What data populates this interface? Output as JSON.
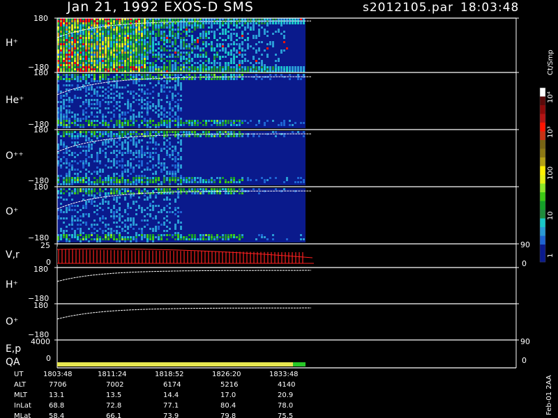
{
  "header": {
    "title": "Jan 21, 1992   EXOS-D SMS",
    "file": "s2012105.par",
    "time": "18:03:48"
  },
  "colorbar": {
    "unit": "Ct/Smp",
    "tick_labels": [
      "1",
      "10",
      "100",
      "10³",
      "10⁴"
    ],
    "colors": [
      "#0a1a8c",
      "#0a1a8c",
      "#1e64d2",
      "#2a9bd6",
      "#19c8c8",
      "#1f8c3c",
      "#14a028",
      "#3cc814",
      "#8ce628",
      "#e6f014",
      "#fff000",
      "#b4a014",
      "#8c7814",
      "#786414",
      "#c83214",
      "#ff1400",
      "#b41414",
      "#8c0a0a",
      "#5a0a0a",
      "#ffffff"
    ]
  },
  "panels": {
    "hplus_label": "H⁺",
    "heplus_label": "He⁺",
    "opp_label": "O⁺⁺",
    "oplus_label": "O⁺",
    "vr_label": "V,r",
    "hplus2_label": "H⁺",
    "oplus2_label": "O⁺",
    "ep_label": "E,p",
    "qa_label": "QA",
    "tick_pos": "180",
    "tick_neg": "−180",
    "vr_top": "25",
    "vr_zero": "0",
    "right_90": "90",
    "right_0": "0",
    "ep_top": "4000",
    "ep_zero": "0",
    "ep_90": "90",
    "ep_0": "0"
  },
  "footer": {
    "rows": [
      {
        "label": "UT",
        "values": [
          "1803:48",
          "1811:24",
          "1818:52",
          "1826:20",
          "1833:48"
        ]
      },
      {
        "label": "ALT",
        "values": [
          "7706",
          "7002",
          "6174",
          "5216",
          "4140"
        ]
      },
      {
        "label": "MLT",
        "values": [
          "13.1",
          "13.5",
          "14.4",
          "17.0",
          "20.9"
        ]
      },
      {
        "label": "InLat",
        "values": [
          "68.8",
          "72.8",
          "77.1",
          "80.4",
          "78.0"
        ]
      },
      {
        "label": "MLat",
        "values": [
          "58.4",
          "66.1",
          "73.9",
          "79.8",
          "75.5"
        ]
      }
    ],
    "side_note": "Feb-01 2AA"
  },
  "chart_data": {
    "type": "heatmap",
    "title": "Jan 21, 1992   EXOS-D SMS",
    "x": [
      "1803:48",
      "1811:24",
      "1818:52",
      "1826:20",
      "1833:48"
    ],
    "ylim": [
      -180,
      180
    ],
    "series": [
      {
        "name": "H⁺",
        "pitch_angle_range": [
          -180,
          180
        ]
      },
      {
        "name": "He⁺",
        "pitch_angle_range": [
          -180,
          180
        ]
      },
      {
        "name": "O⁺⁺",
        "pitch_angle_range": [
          -180,
          180
        ]
      },
      {
        "name": "O⁺",
        "pitch_angle_range": [
          -180,
          180
        ]
      }
    ],
    "color_scale": {
      "unit": "Ct/Smp",
      "range": [
        1,
        10000
      ],
      "log": true
    },
    "qa_status": [
      "good",
      "good",
      "good",
      "good",
      "good"
    ]
  }
}
